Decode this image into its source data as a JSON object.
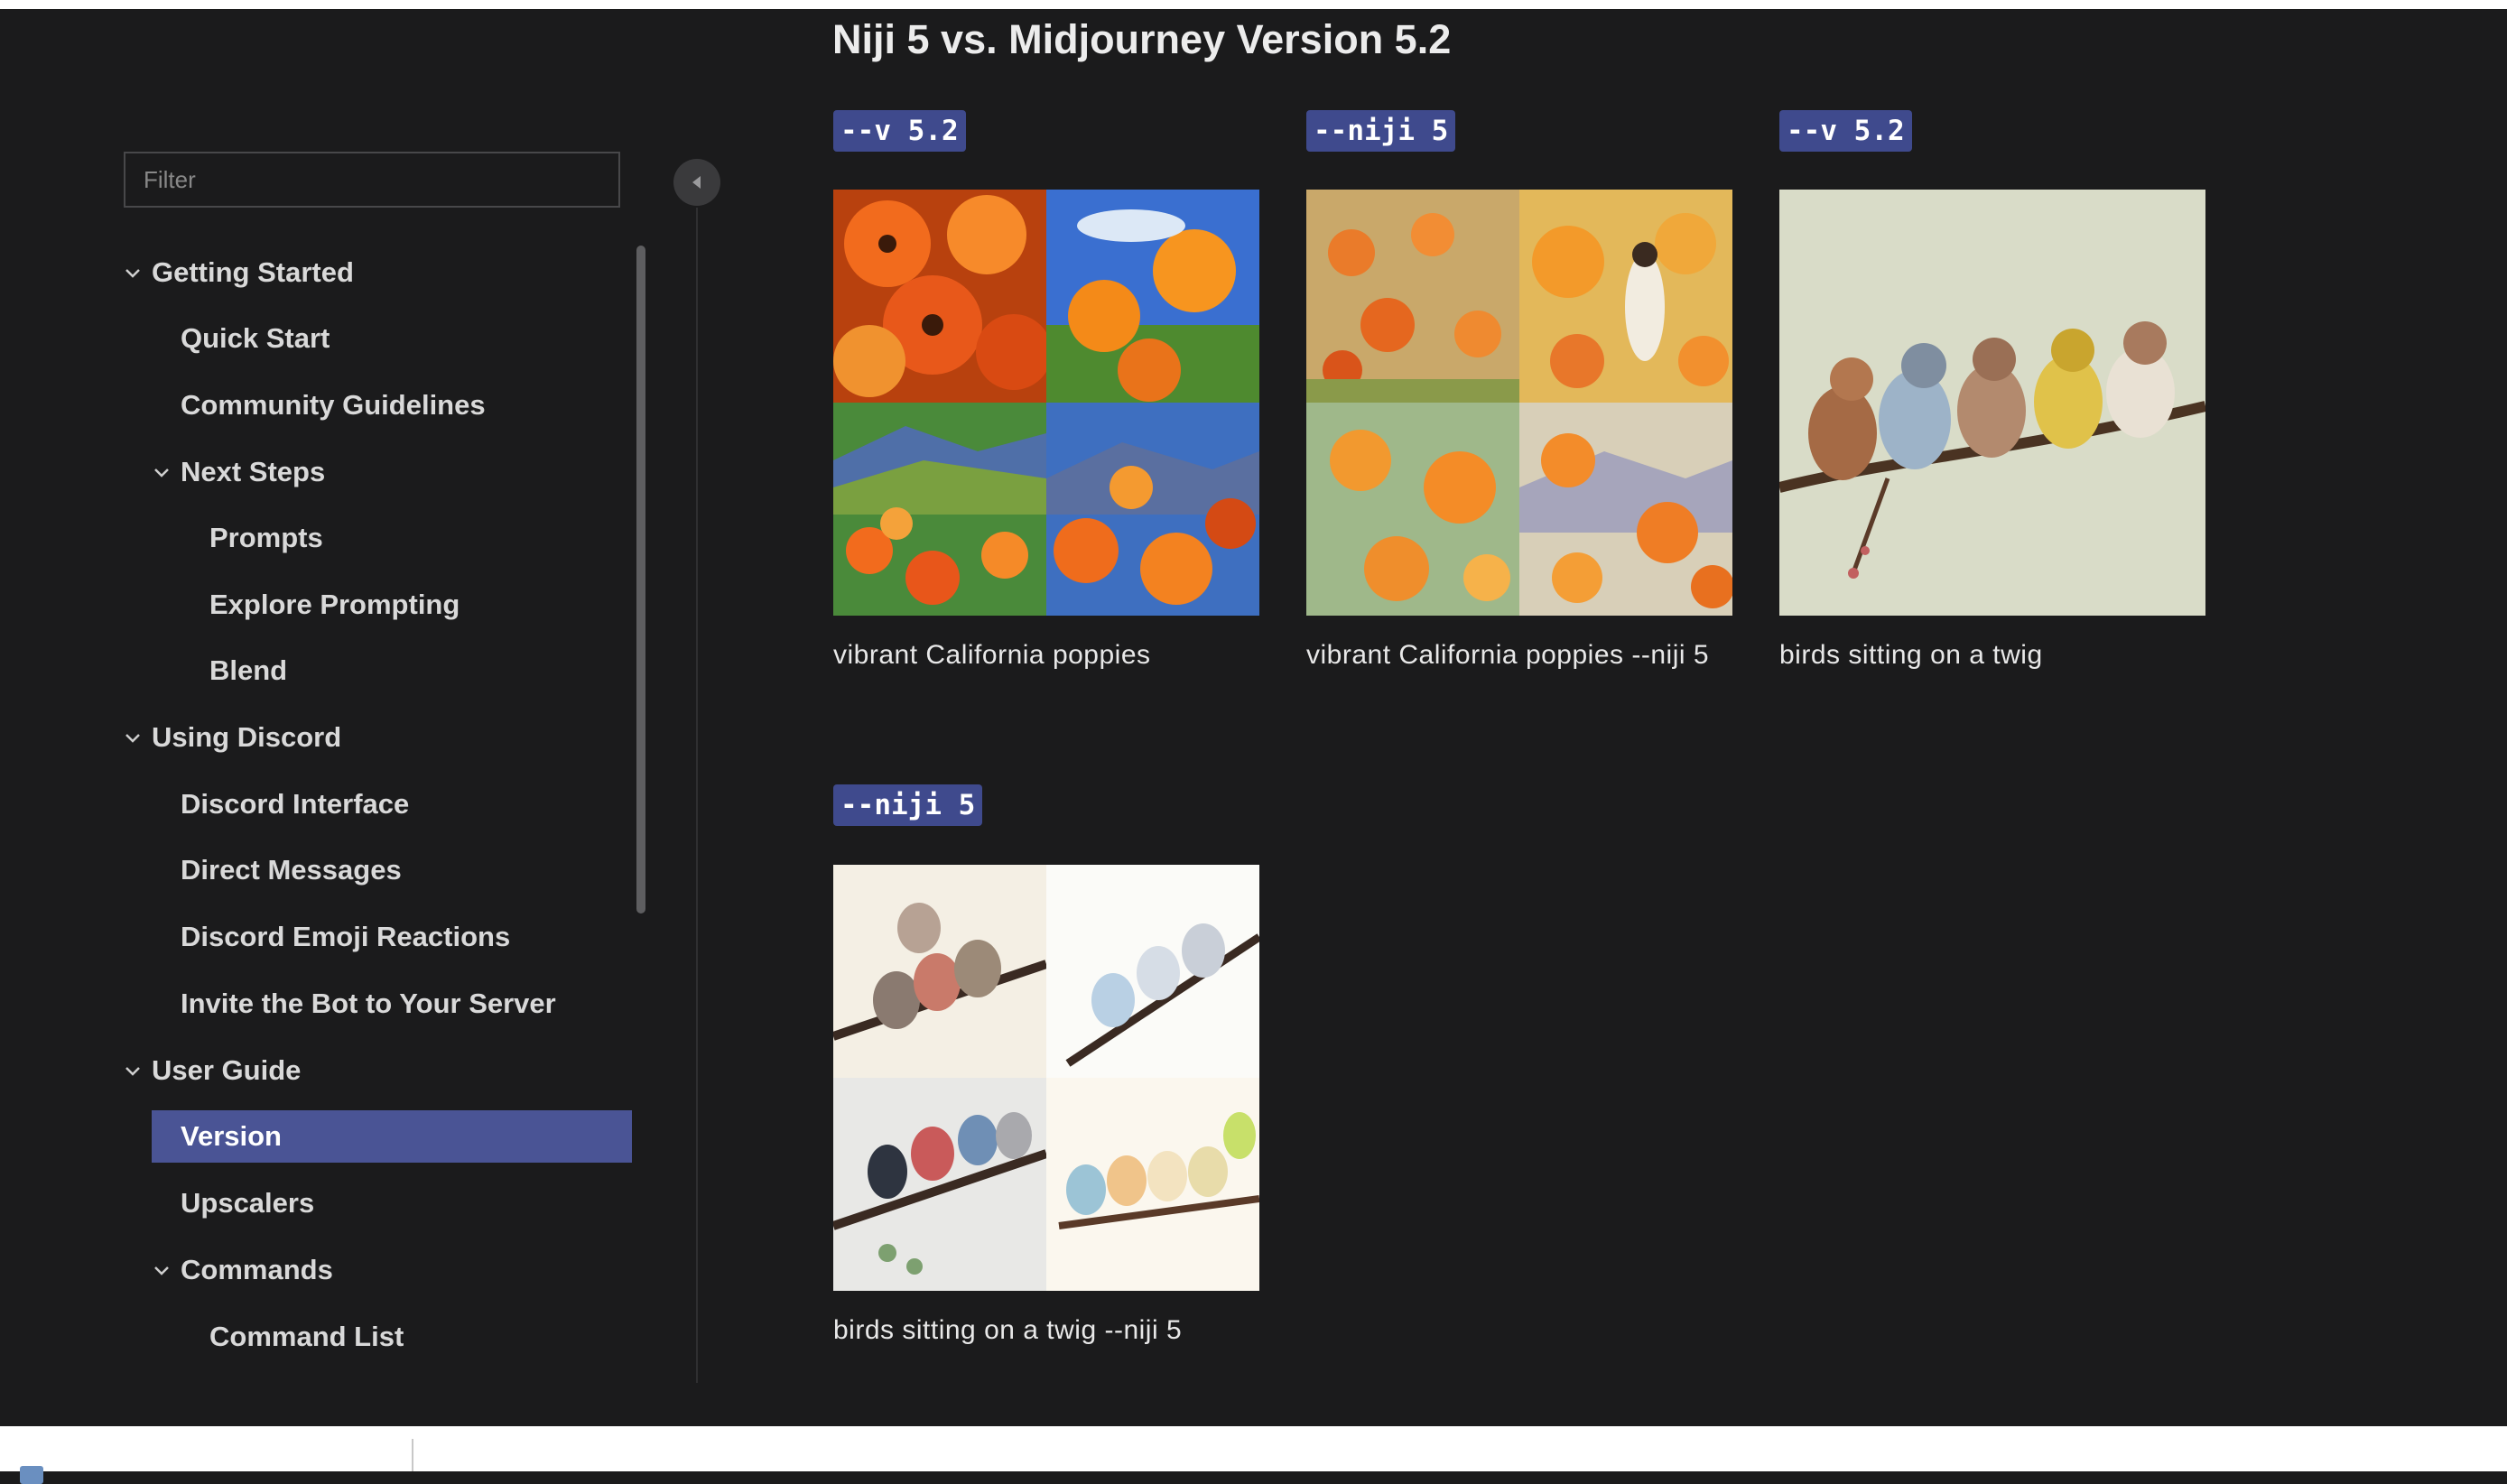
{
  "sidebar": {
    "filter_placeholder": "Filter",
    "items": [
      {
        "label": "Getting Started"
      },
      {
        "label": "Quick Start"
      },
      {
        "label": "Community Guidelines"
      },
      {
        "label": "Next Steps"
      },
      {
        "label": "Prompts"
      },
      {
        "label": "Explore Prompting"
      },
      {
        "label": "Blend"
      },
      {
        "label": "Using Discord"
      },
      {
        "label": "Discord Interface"
      },
      {
        "label": "Direct Messages"
      },
      {
        "label": "Discord Emoji Reactions"
      },
      {
        "label": "Invite the Bot to Your Server"
      },
      {
        "label": "User Guide"
      },
      {
        "label": "Version"
      },
      {
        "label": "Upscalers"
      },
      {
        "label": "Commands"
      },
      {
        "label": "Command List"
      }
    ],
    "active_item": "Version",
    "active_color": "#4a5495"
  },
  "main": {
    "title": "Niji 5 vs. Midjourney Version 5.2",
    "examples": [
      {
        "badge": "--v 5.2",
        "caption": "vibrant California poppies",
        "image_subject": "poppies"
      },
      {
        "badge": "--niji 5",
        "caption": "vibrant California poppies --niji 5",
        "image_subject": "poppies-anime"
      },
      {
        "badge": "--v 5.2",
        "caption": "birds sitting on a twig",
        "image_subject": "birds"
      },
      {
        "badge": "--niji 5",
        "caption": "birds sitting on a twig --niji 5",
        "image_subject": "birds-anime"
      }
    ],
    "badge_color": "#3f4a8d"
  }
}
